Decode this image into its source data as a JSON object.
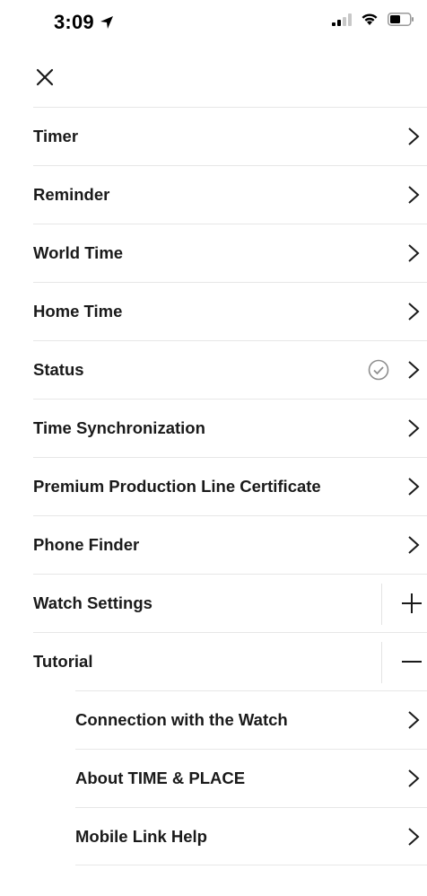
{
  "status_bar": {
    "time": "3:09",
    "icons": [
      "location-arrow-icon",
      "signal-icon",
      "wifi-icon",
      "battery-icon"
    ]
  },
  "header": {
    "close_icon": "close-icon"
  },
  "menu": {
    "items": [
      {
        "label": "Timer",
        "accessory": "chevron"
      },
      {
        "label": "Reminder",
        "accessory": "chevron"
      },
      {
        "label": "World Time",
        "accessory": "chevron"
      },
      {
        "label": "Home Time",
        "accessory": "chevron"
      },
      {
        "label": "Status",
        "accessory": "chevron",
        "badge": "check-circle-icon"
      },
      {
        "label": "Time Synchronization",
        "accessory": "chevron"
      },
      {
        "label": "Premium Production Line Certificate",
        "accessory": "chevron"
      },
      {
        "label": "Phone Finder",
        "accessory": "chevron"
      },
      {
        "label": "Watch Settings",
        "accessory": "plus",
        "expanded": false
      },
      {
        "label": "Tutorial",
        "accessory": "minus",
        "expanded": true
      }
    ],
    "tutorial_subitems": [
      {
        "label": "Connection with the Watch"
      },
      {
        "label": "About TIME & PLACE"
      },
      {
        "label": "Mobile Link Help"
      }
    ]
  },
  "colors": {
    "text": "#1a1a1a",
    "divider": "#e7e7e7",
    "icon_gray": "#8e8e8e",
    "background": "#ffffff"
  }
}
